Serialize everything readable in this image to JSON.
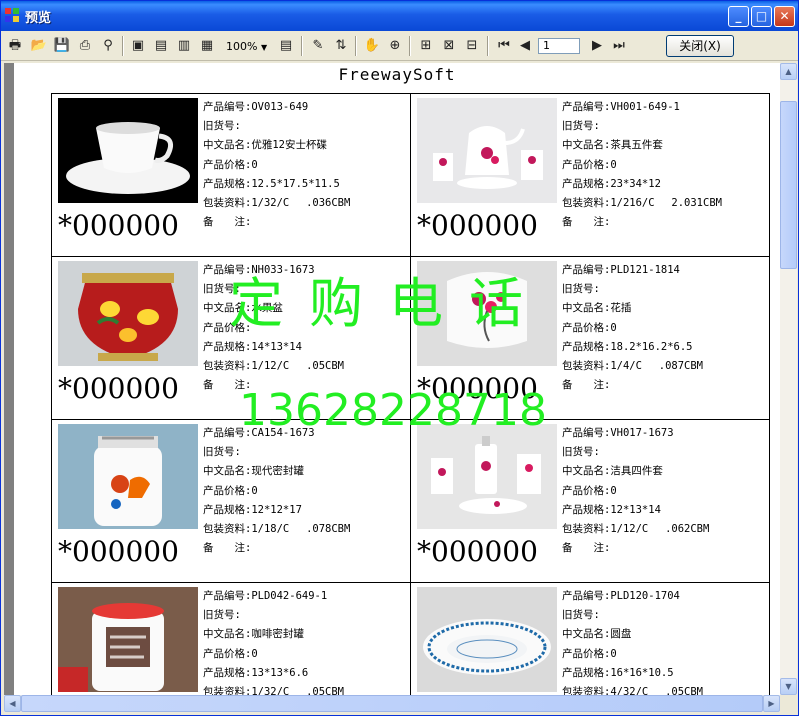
{
  "window": {
    "title": "预览",
    "app_icon": "report-icon"
  },
  "title_buttons": {
    "minimize": "_",
    "maximize": "□",
    "close": "✕"
  },
  "toolbar": {
    "zoom": "100%",
    "page_number": "1",
    "close_label": "关闭(X)"
  },
  "report": {
    "company": "FreewaySoft",
    "labels": {
      "code": "产品编号:",
      "old_code": "旧货号:",
      "cn_name": "中文品名:",
      "price": "产品价格:",
      "spec": "产品规格:",
      "packing": "包装资料:",
      "remark": "备　　注:"
    },
    "products": [
      {
        "code": "OV013-649",
        "old_code": "",
        "cn_name": "优雅12安士杯碟",
        "price": "0",
        "spec": "12.5*17.5*11.5",
        "packing": "1/32/C　 .036CBM",
        "price_tag": "*000000",
        "photo": "white-cup-saucer"
      },
      {
        "code": "VH001-649-1",
        "old_code": "",
        "cn_name": "茶具五件套",
        "price": "0",
        "spec": "23*34*12",
        "packing": "1/216/C　 2.031CBM",
        "price_tag": "*000000",
        "photo": "floral-tea-set"
      },
      {
        "code": "NH033-1673",
        "old_code": "",
        "cn_name": "水果盆",
        "price": "",
        "spec": "14*13*14",
        "packing": "1/12/C　 .05CBM",
        "price_tag": "*000000",
        "photo": "lemon-pot"
      },
      {
        "code": "PLD121-1814",
        "old_code": "",
        "cn_name": "花插",
        "price": "0",
        "spec": "18.2*16.2*6.5",
        "packing": "1/4/C　 .087CBM",
        "price_tag": "*000000",
        "photo": "orchid-vase"
      },
      {
        "code": "CA154-1673",
        "old_code": "",
        "cn_name": "现代密封罐",
        "price": "0",
        "spec": "12*12*17",
        "packing": "1/18/C　 .078CBM",
        "price_tag": "*000000",
        "photo": "rooster-jar"
      },
      {
        "code": "VH017-1673",
        "old_code": "",
        "cn_name": "洁具四件套",
        "price": "0",
        "spec": "12*13*14",
        "packing": "1/12/C　 .062CBM",
        "price_tag": "*000000",
        "photo": "bath-set"
      },
      {
        "code": "PLD042-649-1",
        "old_code": "",
        "cn_name": "咖啡密封罐",
        "price": "0",
        "spec": "13*13*6.6",
        "packing": "1/32/C　 .05CBM",
        "price_tag": "",
        "photo": "coffee-jar"
      },
      {
        "code": "PLD120-1704",
        "old_code": "",
        "cn_name": "圆盘",
        "price": "0",
        "spec": "16*16*10.5",
        "packing": "4/32/C　 .05CBM",
        "price_tag": "",
        "photo": "blue-plate"
      }
    ],
    "watermark_line1": "定购电话",
    "watermark_line2": "13628228718"
  }
}
